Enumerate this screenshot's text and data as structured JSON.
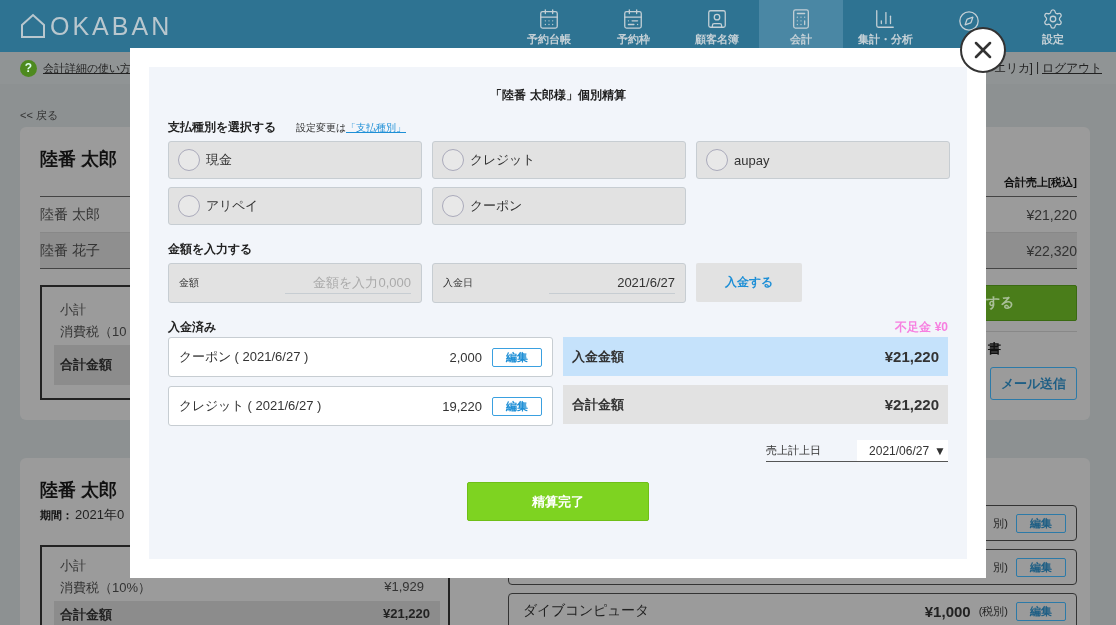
{
  "header": {
    "logo": "OKABAN",
    "nav": [
      {
        "label": "予約台帳",
        "selected": false
      },
      {
        "label": "予約枠",
        "selected": false
      },
      {
        "label": "顧客名簿",
        "selected": false
      },
      {
        "label": "会計",
        "selected": true
      },
      {
        "label": "集計・分析",
        "selected": false
      },
      {
        "selected": false
      },
      {
        "label": "設定",
        "selected": false
      }
    ]
  },
  "help_bar": {
    "help_mark": "?",
    "help_link": "会計詳細の使い方",
    "user": "エリカ]",
    "separator": "|",
    "logout": "ログアウト"
  },
  "back_link": "<< 戻る",
  "summary_card": {
    "title": "陸番 太郎",
    "column_header": "合計売上[税込]",
    "rows": [
      {
        "name": "陸番 太郎",
        "amount": "¥21,220"
      },
      {
        "name": "陸番 花子",
        "amount": "¥22,320"
      }
    ],
    "totals": {
      "subtotal_label": "小計",
      "tax_label": "消費税（10",
      "total_label": "合計金額"
    },
    "settle_button": "する",
    "statement_label": "書",
    "mail_button": "メール送信"
  },
  "period_card": {
    "title": "陸番 太郎",
    "period_label": "期間：",
    "period_value": "2021年0",
    "totals": {
      "subtotal_label": "小計",
      "tax_label": "消費税（10%）",
      "tax_value": "¥1,929",
      "total_label": "合計金額",
      "total_value": "¥21,220"
    },
    "items": [
      {
        "tax": "別)",
        "edit": "編集"
      },
      {
        "tax": "別)",
        "edit": "編集"
      },
      {
        "name": "ダイブコンピュータ",
        "price": "¥1,000",
        "tax": "(税別)",
        "edit": "編集"
      }
    ]
  },
  "modal": {
    "title": "「陸番 太郎様」個別精算",
    "payment_type": {
      "heading": "支払種別を選択する",
      "note": "設定変更は",
      "link": "「支払種別」",
      "options": [
        {
          "label": "現金",
          "selected": false
        },
        {
          "label": "クレジット",
          "selected": false
        },
        {
          "label": "aupay",
          "selected": false
        },
        {
          "label": "アリペイ",
          "selected": false
        },
        {
          "label": "クーポン",
          "selected": false
        }
      ]
    },
    "amount": {
      "heading": "金額を入力する",
      "amount_field": {
        "label": "金額",
        "placeholder": "金額を入力0,000"
      },
      "date_field": {
        "label": "入金日",
        "value": "2021/6/27"
      },
      "deposit_button": "入金する"
    },
    "paid": {
      "heading": "入金済み",
      "shortage": "不足金 ¥0",
      "entries": [
        {
          "label": "クーポン ( 2021/6/27 )",
          "amount": "2,000",
          "edit": "編集"
        },
        {
          "label": "クレジット ( 2021/6/27 )",
          "amount": "19,220",
          "edit": "編集"
        }
      ],
      "summary": [
        {
          "kind": "paid",
          "label": "入金金額",
          "value": "¥21,220"
        },
        {
          "kind": "total",
          "label": "合計金額",
          "value": "¥21,220"
        }
      ]
    },
    "sales_date": {
      "label": "売上計上日",
      "value": "2021/06/27",
      "arrow": "▼"
    },
    "complete_button": "精算完了"
  }
}
